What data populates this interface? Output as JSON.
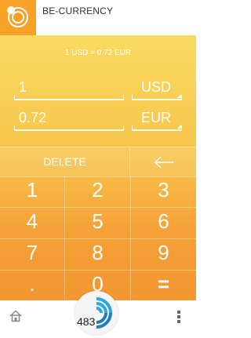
{
  "app": {
    "title": "BE-CURRENCY",
    "logo_icon": "currency-coins-icon",
    "accent": "#F7A227"
  },
  "converter": {
    "rate_text": "1 USD = 0.72 EUR",
    "from": {
      "amount": "1",
      "currency": "USD"
    },
    "to": {
      "amount": "0.72",
      "currency": "EUR"
    }
  },
  "keypad": {
    "delete_label": "DELETE",
    "backspace_icon": "arrow-left-icon",
    "keys": [
      "1",
      "2",
      "3",
      "4",
      "5",
      "6",
      "7",
      "8",
      "9",
      ".",
      "0",
      "="
    ]
  },
  "bottom_bar": {
    "home_icon": "home-icon",
    "fab_count": "483",
    "more_icon": "more-vertical-icon"
  }
}
